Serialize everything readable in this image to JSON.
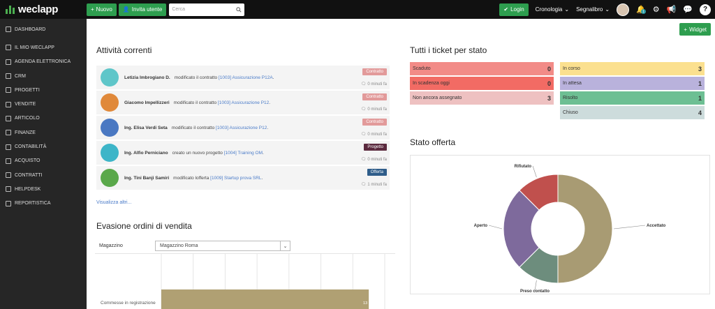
{
  "topbar": {
    "logo": "weclapp",
    "new_label": "Nuovo",
    "invite_label": "Invita utente",
    "search_placeholder": "Cerca",
    "login_label": "Login",
    "history_label": "Cronologia",
    "bookmark_label": "Segnalibro",
    "notification_count": "1",
    "help_label": "?"
  },
  "sidebar": {
    "items": [
      {
        "label": "Dashboard"
      },
      {
        "label": "Il mio weclapp"
      },
      {
        "label": "Agenda elettronica"
      },
      {
        "label": "CRM"
      },
      {
        "label": "Progetti"
      },
      {
        "label": "Vendite"
      },
      {
        "label": "Articolo"
      },
      {
        "label": "Finanze"
      },
      {
        "label": "Contabilità"
      },
      {
        "label": "Acquisto"
      },
      {
        "label": "Contratti"
      },
      {
        "label": "Helpdesk"
      },
      {
        "label": "Reportistica"
      }
    ]
  },
  "widget_label": "Widget",
  "activities": {
    "title": "Attività correnti",
    "show_more": "Visualizza altri...",
    "items": [
      {
        "name": "Letizia Imbrogiano D.",
        "action": "modificato il contratto",
        "link": "[1003] Assicurazione P12A",
        "tail": ".",
        "tag": "Contratto",
        "tag_color": "#e29a9a",
        "time": "0 minuti fa",
        "avatar_color": "#5fc6c9"
      },
      {
        "name": "Giacomo Impellizzeri",
        "action": "modificato il contratto",
        "link": "[1003] Assicurazione P12",
        "tail": ".",
        "tag": "Contratto",
        "tag_color": "#e29a9a",
        "time": "0 minuti fa",
        "avatar_color": "#e0893a"
      },
      {
        "name": "Ing. Elisa Verdi Seta",
        "action": "modificato il contratto",
        "link": "[1003] Assicurazione P12",
        "tail": ".",
        "tag": "Contratto",
        "tag_color": "#e29a9a",
        "time": "0 minuti fa",
        "avatar_color": "#4a78c2"
      },
      {
        "name": "Ing. Alfio Perniciano",
        "action": "creato un nuovo progetto",
        "link": "[1004] Training OM",
        "tail": ".",
        "tag": "Progetto",
        "tag_color": "#5b2a3e",
        "time": "0 minuti fa",
        "avatar_color": "#3db5c8"
      },
      {
        "name": "Ing. Tini Banji Samiri",
        "action": "modificato lofferta",
        "link": "[1009] Startup prova SRL",
        "tail": ".",
        "tag": "Offerta",
        "tag_color": "#2f5d8a",
        "time": "1 minuti fa",
        "avatar_color": "#5aa84a"
      }
    ]
  },
  "sales": {
    "title": "Evasione ordini di vendita",
    "warehouse_label": "Magazzino",
    "warehouse_value": "Magazzino Roma"
  },
  "tickets": {
    "title": "Tutti i ticket per stato",
    "items": [
      {
        "label": "Scaduto",
        "count": "0",
        "color": "#f28b87"
      },
      {
        "label": "In scadenza oggi",
        "count": "0",
        "color": "#f26b64"
      },
      {
        "label": "Non ancora assegnato",
        "count": "3",
        "color": "#eec1c1"
      },
      {
        "label": "In corso",
        "count": "3",
        "color": "#fbe08f"
      },
      {
        "label": "In attesa",
        "count": "1",
        "color": "#b9b2dc"
      },
      {
        "label": "Risolto",
        "count": "1",
        "color": "#6dbf93"
      },
      {
        "label": "Chiuso",
        "count": "4",
        "color": "#cddcdc"
      }
    ]
  },
  "chart_data": [
    {
      "type": "bar",
      "orientation": "horizontal",
      "title": "",
      "categories": [
        "Commesse in registrazione"
      ],
      "values": [
        13
      ],
      "color": "#b0a073",
      "grid": true
    },
    {
      "type": "pie",
      "title": "Stato offerta",
      "donut": true,
      "labels": [
        "Accettato",
        "Preso contatto",
        "Aperto",
        "Rifiutato"
      ],
      "values": [
        50,
        12.5,
        25,
        12.5
      ],
      "colors": [
        "#a89b73",
        "#6d8d7d",
        "#7e6a9c",
        "#c0504d"
      ]
    }
  ]
}
